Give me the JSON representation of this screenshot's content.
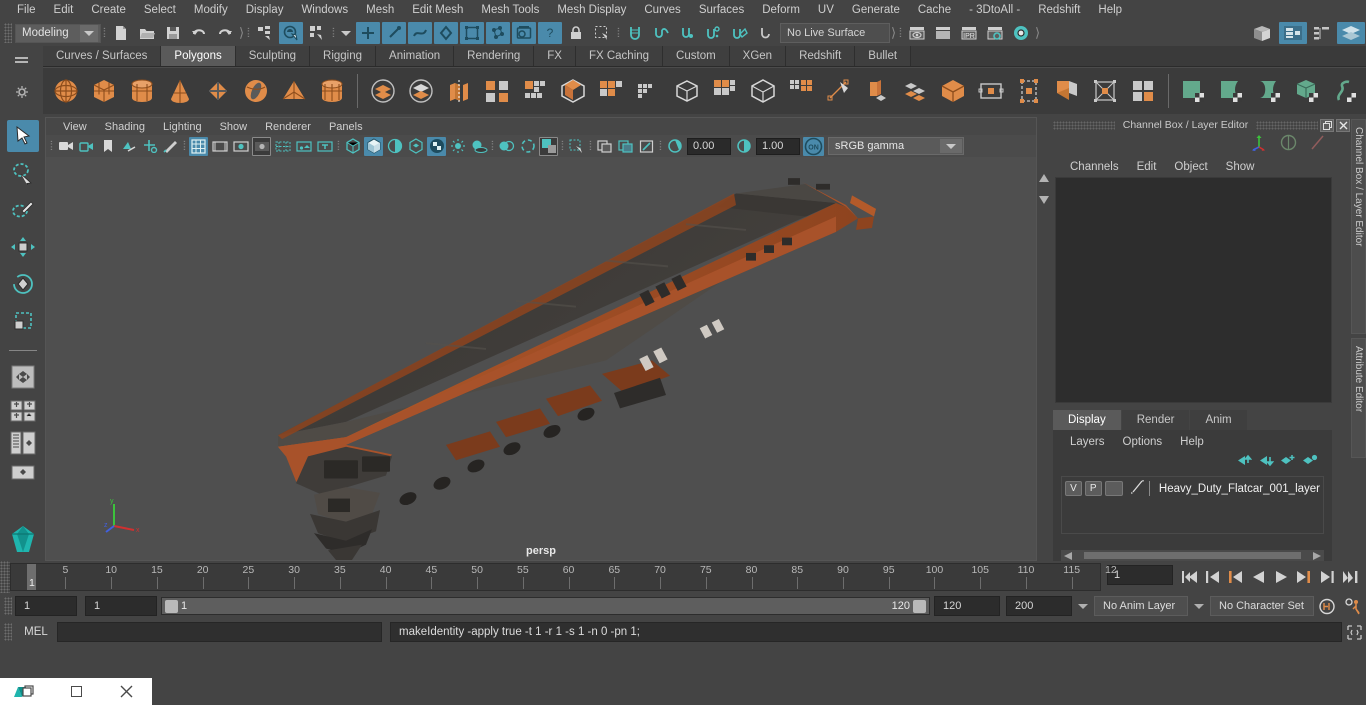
{
  "app": {
    "name": "Autodesk Maya"
  },
  "menubar": {
    "items": [
      "File",
      "Edit",
      "Create",
      "Select",
      "Modify",
      "Display",
      "Windows",
      "Mesh",
      "Edit Mesh",
      "Mesh Tools",
      "Mesh Display",
      "Curves",
      "Surfaces",
      "Deform",
      "UV",
      "Generate",
      "Cache",
      "- 3DtoAll -",
      "Redshift",
      "Help"
    ]
  },
  "statusline": {
    "mode_value": "Modeling",
    "live_surface": "No Live Surface",
    "icons": [
      "new-scene-icon",
      "open-scene-icon",
      "save-scene-icon",
      "undo-icon",
      "redo-icon",
      "select-by-hierarchy-icon",
      "select-by-object-icon",
      "select-by-component-icon",
      "select-vertex-icon",
      "select-edge-icon",
      "select-face-icon",
      "select-uv-icon",
      "select-vertex-face-icon",
      "select-multi-icon",
      "select-handle-icon",
      "select-help-icon",
      "lock-icon",
      "marquee-select-icon",
      "snap-grid-icon",
      "snap-curve-icon",
      "snap-point-icon",
      "snap-projected-icon",
      "snap-view-plane-icon",
      "make-live-icon",
      "render-current-frame-icon",
      "ipr-render-icon",
      "render-settings-icon",
      "hypershade-icon",
      "render-view-icon",
      "show-attribute-editor-icon",
      "show-tool-settings-icon",
      "show-channel-box-icon",
      "show-modeling-toolkit-icon"
    ]
  },
  "shelf": {
    "tabs": [
      "Curves / Surfaces",
      "Polygons",
      "Sculpting",
      "Rigging",
      "Animation",
      "Rendering",
      "FX",
      "FX Caching",
      "Custom",
      "XGen",
      "Redshift",
      "Bullet"
    ],
    "active_tab": "Polygons",
    "icons": [
      "poly-sphere-icon",
      "poly-cube-icon",
      "poly-cylinder-icon",
      "poly-cone-icon",
      "poly-plane-icon",
      "poly-torus-icon",
      "poly-pyramid-icon",
      "poly-prism-icon",
      "combine-icon",
      "separate-icon",
      "extract-icon",
      "mirror-geometry-icon",
      "boolean-icon",
      "smooth-icon",
      "bevel-icon",
      "bridge-icon",
      "append-polygon-icon",
      "wedge-face-icon",
      "insert-edge-loop-icon",
      "offset-edge-loop-icon",
      "multi-cut-icon",
      "connect-icon",
      "detach-icon",
      "merge-icon",
      "target-weld-icon",
      "crease-icon",
      "duplicate-face-icon",
      "quad-draw-icon",
      "uv-editor-icon",
      "uv-checker-icon"
    ]
  },
  "toolbox": {
    "items": [
      "select-tool",
      "lasso-select-tool",
      "paint-select-tool",
      "move-tool",
      "rotate-tool",
      "scale-tool",
      "last-tool-used",
      "single-pane-layout",
      "two-pane-layout",
      "four-pane-layout",
      "outliner-persp-layout",
      "persp-graph-layout",
      "hypershade-persp-layout"
    ],
    "active": "select-tool"
  },
  "viewport": {
    "menu": [
      "View",
      "Shading",
      "Lighting",
      "Show",
      "Renderer",
      "Panels"
    ],
    "toolbar_icons": [
      "select-camera-icon",
      "camera-attributes-icon",
      "bookmark-icon",
      "image-plane-icon",
      "2d-pan-zoom-icon",
      "grease-pencil-icon",
      "grid-icon",
      "film-gate-icon",
      "resolution-gate-icon",
      "gate-mask-icon",
      "field-chart-icon",
      "safe-action-icon",
      "safe-title-icon",
      "wireframe-icon",
      "smooth-shade-icon",
      "flat-shade-icon",
      "shaded-wireframe-icon",
      "textured-icon",
      "lighting-icon",
      "shadows-icon",
      "screen-space-ao-icon",
      "motion-blur-icon",
      "multisample-icon",
      "depth-of-field-icon",
      "isolate-select-icon",
      "xray-icon",
      "xray-joints-icon",
      "xray-active-components-icon",
      "exposure-icon",
      "gamma-icon"
    ],
    "exposure_value": "0.00",
    "gamma_value": "1.00",
    "view_transform": "sRGB gamma",
    "color_mgmt_toggle": "ON",
    "camera_label": "persp",
    "axis_labels": {
      "x": "x",
      "y": "y",
      "z": "z"
    }
  },
  "channel_box": {
    "title": "Channel Box / Layer Editor",
    "menu": [
      "Channels",
      "Edit",
      "Object",
      "Show"
    ],
    "window_buttons": [
      "restore-icon",
      "close-icon"
    ],
    "tool_icons": [
      "move-tool-icon",
      "rotate-tool-icon",
      "scale-tool-icon"
    ]
  },
  "layer_editor": {
    "tabs": [
      "Display",
      "Render",
      "Anim"
    ],
    "active_tab": "Display",
    "menu": [
      "Layers",
      "Options",
      "Help"
    ],
    "buttons": [
      "move-layer-up-icon",
      "move-layer-down-icon",
      "new-layer-icon",
      "new-layer-from-selected-icon"
    ],
    "layers": [
      {
        "visibility": "V",
        "playback": "P",
        "shading": "",
        "name": "Heavy_Duty_Flatcar_001_layer"
      }
    ]
  },
  "vertical_tabs": [
    "Channel Box / Layer Editor",
    "Attribute Editor"
  ],
  "time_slider": {
    "tick_labels": [
      "5",
      "10",
      "15",
      "20",
      "25",
      "30",
      "35",
      "40",
      "45",
      "50",
      "55",
      "60",
      "65",
      "70",
      "75",
      "80",
      "85",
      "90",
      "95",
      "100",
      "105",
      "110",
      "115",
      "12"
    ],
    "current_frame_marker": "1",
    "current_frame_field": "1",
    "playback_buttons": [
      "go-to-start-icon",
      "step-back-keyframe-icon",
      "step-back-frame-icon",
      "play-backwards-icon",
      "play-forwards-icon",
      "step-forward-frame-icon",
      "step-forward-keyframe-icon",
      "go-to-end-icon"
    ]
  },
  "range_slider": {
    "anim_start": "1",
    "range_start": "1",
    "range_bar_start": "1",
    "range_bar_end": "120",
    "range_end": "120",
    "anim_end": "200",
    "anim_layer": "No Anim Layer",
    "character_set": "No Character Set",
    "right_icons": [
      "auto-keyframe-icon",
      "animation-preferences-icon"
    ]
  },
  "command_line": {
    "language_label": "MEL",
    "input_value": "",
    "output_value": "makeIdentity -apply true -t 1 -r 1 -s 1 -n 0 -pn 1;",
    "script_editor_icon": "script-editor-icon"
  },
  "taskbar": {
    "items": [
      "maya-app-icon",
      "restore-window-icon",
      "maximize-window-icon",
      "close-window-icon"
    ]
  },
  "colors": {
    "accent_blue": "#4a8aab",
    "shelf_orange": "#e08c49",
    "teal": "#4aa9a1",
    "green": "#63a98c",
    "bg_dark": "#444444",
    "panel_dark": "#2d2d2d",
    "model_orange": "#a8522a"
  }
}
